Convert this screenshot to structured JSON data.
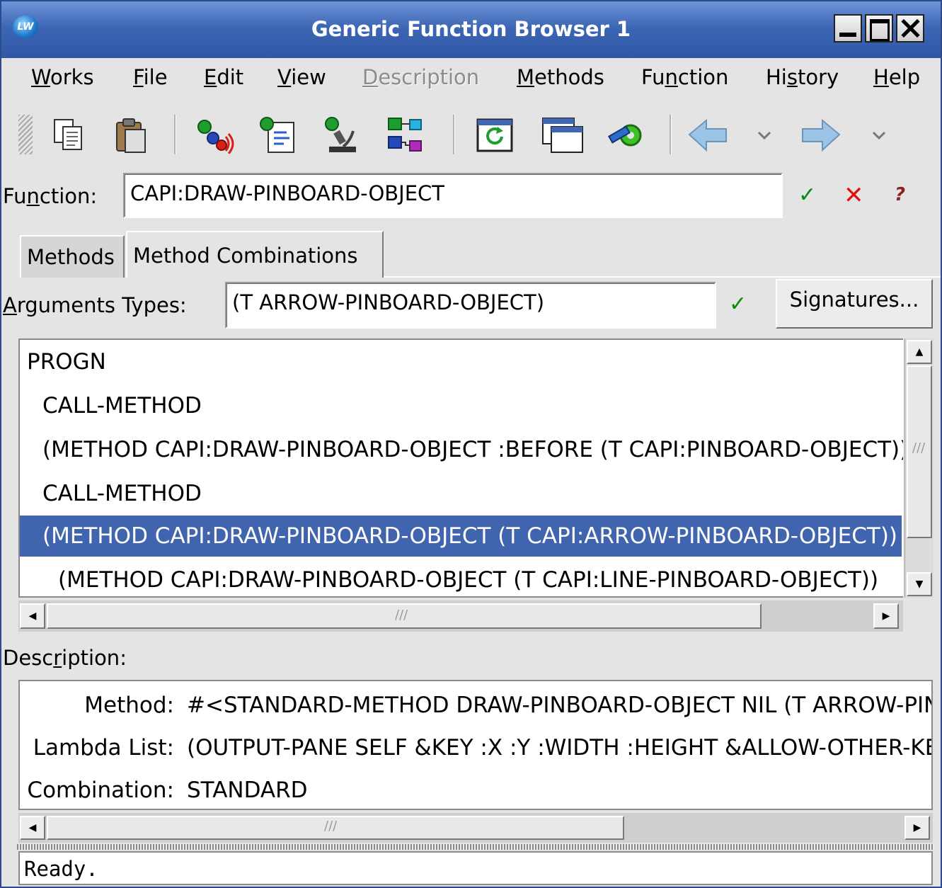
{
  "window": {
    "title": "Generic Function Browser 1",
    "logo_text": "LW",
    "accent_color": "#3d66b5",
    "selection_color": "#4064ad"
  },
  "menubar": {
    "items": [
      {
        "pre": "",
        "u": "W",
        "post": "orks"
      },
      {
        "pre": "",
        "u": "F",
        "post": "ile"
      },
      {
        "pre": "",
        "u": "E",
        "post": "dit"
      },
      {
        "pre": "",
        "u": "V",
        "post": "iew"
      },
      {
        "pre": "",
        "u": "D",
        "post": "escription"
      },
      {
        "pre": "",
        "u": "M",
        "post": "ethods"
      },
      {
        "pre": "Fu",
        "u": "n",
        "post": "ction"
      },
      {
        "pre": "Hi",
        "u": "s",
        "post": "tory"
      },
      {
        "pre": "",
        "u": "H",
        "post": "elp"
      }
    ]
  },
  "toolbar": {
    "icons": [
      "copy-icon",
      "paste-icon",
      "inspect-icon",
      "listener-icon",
      "inspect-object-icon",
      "class-browser-icon",
      "refresh-icon",
      "new-window-icon",
      "tools-icon",
      "back-arrow-icon",
      "history-dropdown-icon",
      "forward-arrow-icon",
      "history-dropdown-icon"
    ]
  },
  "function_row": {
    "label_pre": "Fu",
    "label_u": "n",
    "label_post": "ction:",
    "value": "CAPI:DRAW-PINBOARD-OBJECT",
    "ok_glyph": "✓",
    "cancel_glyph": "✕",
    "help_glyph": "?"
  },
  "tabs": [
    {
      "label": "Methods",
      "active": false
    },
    {
      "label": "Method Combinations",
      "active": true
    }
  ],
  "arguments_row": {
    "label_u": "A",
    "label_post": "rguments Types:",
    "value": "(T ARROW-PINBOARD-OBJECT)",
    "ok_glyph": "✓",
    "signatures_label": "Signatures..."
  },
  "combination_list": {
    "rows": [
      {
        "text": "PROGN",
        "indent": 0,
        "selected": false
      },
      {
        "text": "CALL-METHOD",
        "indent": 1,
        "selected": false
      },
      {
        "text": "(METHOD CAPI:DRAW-PINBOARD-OBJECT :BEFORE (T CAPI:PINBOARD-OBJECT))",
        "indent": 1,
        "selected": false
      },
      {
        "text": "CALL-METHOD",
        "indent": 1,
        "selected": false
      },
      {
        "text": "(METHOD CAPI:DRAW-PINBOARD-OBJECT (T CAPI:ARROW-PINBOARD-OBJECT))",
        "indent": 1,
        "selected": true
      },
      {
        "text": "(METHOD CAPI:DRAW-PINBOARD-OBJECT (T CAPI:LINE-PINBOARD-OBJECT))",
        "indent": 2,
        "selected": false
      }
    ]
  },
  "description": {
    "label_pre": "Desc",
    "label_u": "r",
    "label_post": "iption:",
    "fields": [
      {
        "label": "Method:",
        "value": "#<STANDARD-METHOD DRAW-PINBOARD-OBJECT NIL (T ARROW-PINBOARD-OBJECT)>"
      },
      {
        "label": "Lambda List:",
        "value": "(OUTPUT-PANE SELF &KEY :X :Y :WIDTH :HEIGHT &ALLOW-OTHER-KEYS)"
      },
      {
        "label": "Combination:",
        "value": "STANDARD"
      }
    ]
  },
  "status": {
    "text": "Ready."
  },
  "scroll_grip": "///"
}
